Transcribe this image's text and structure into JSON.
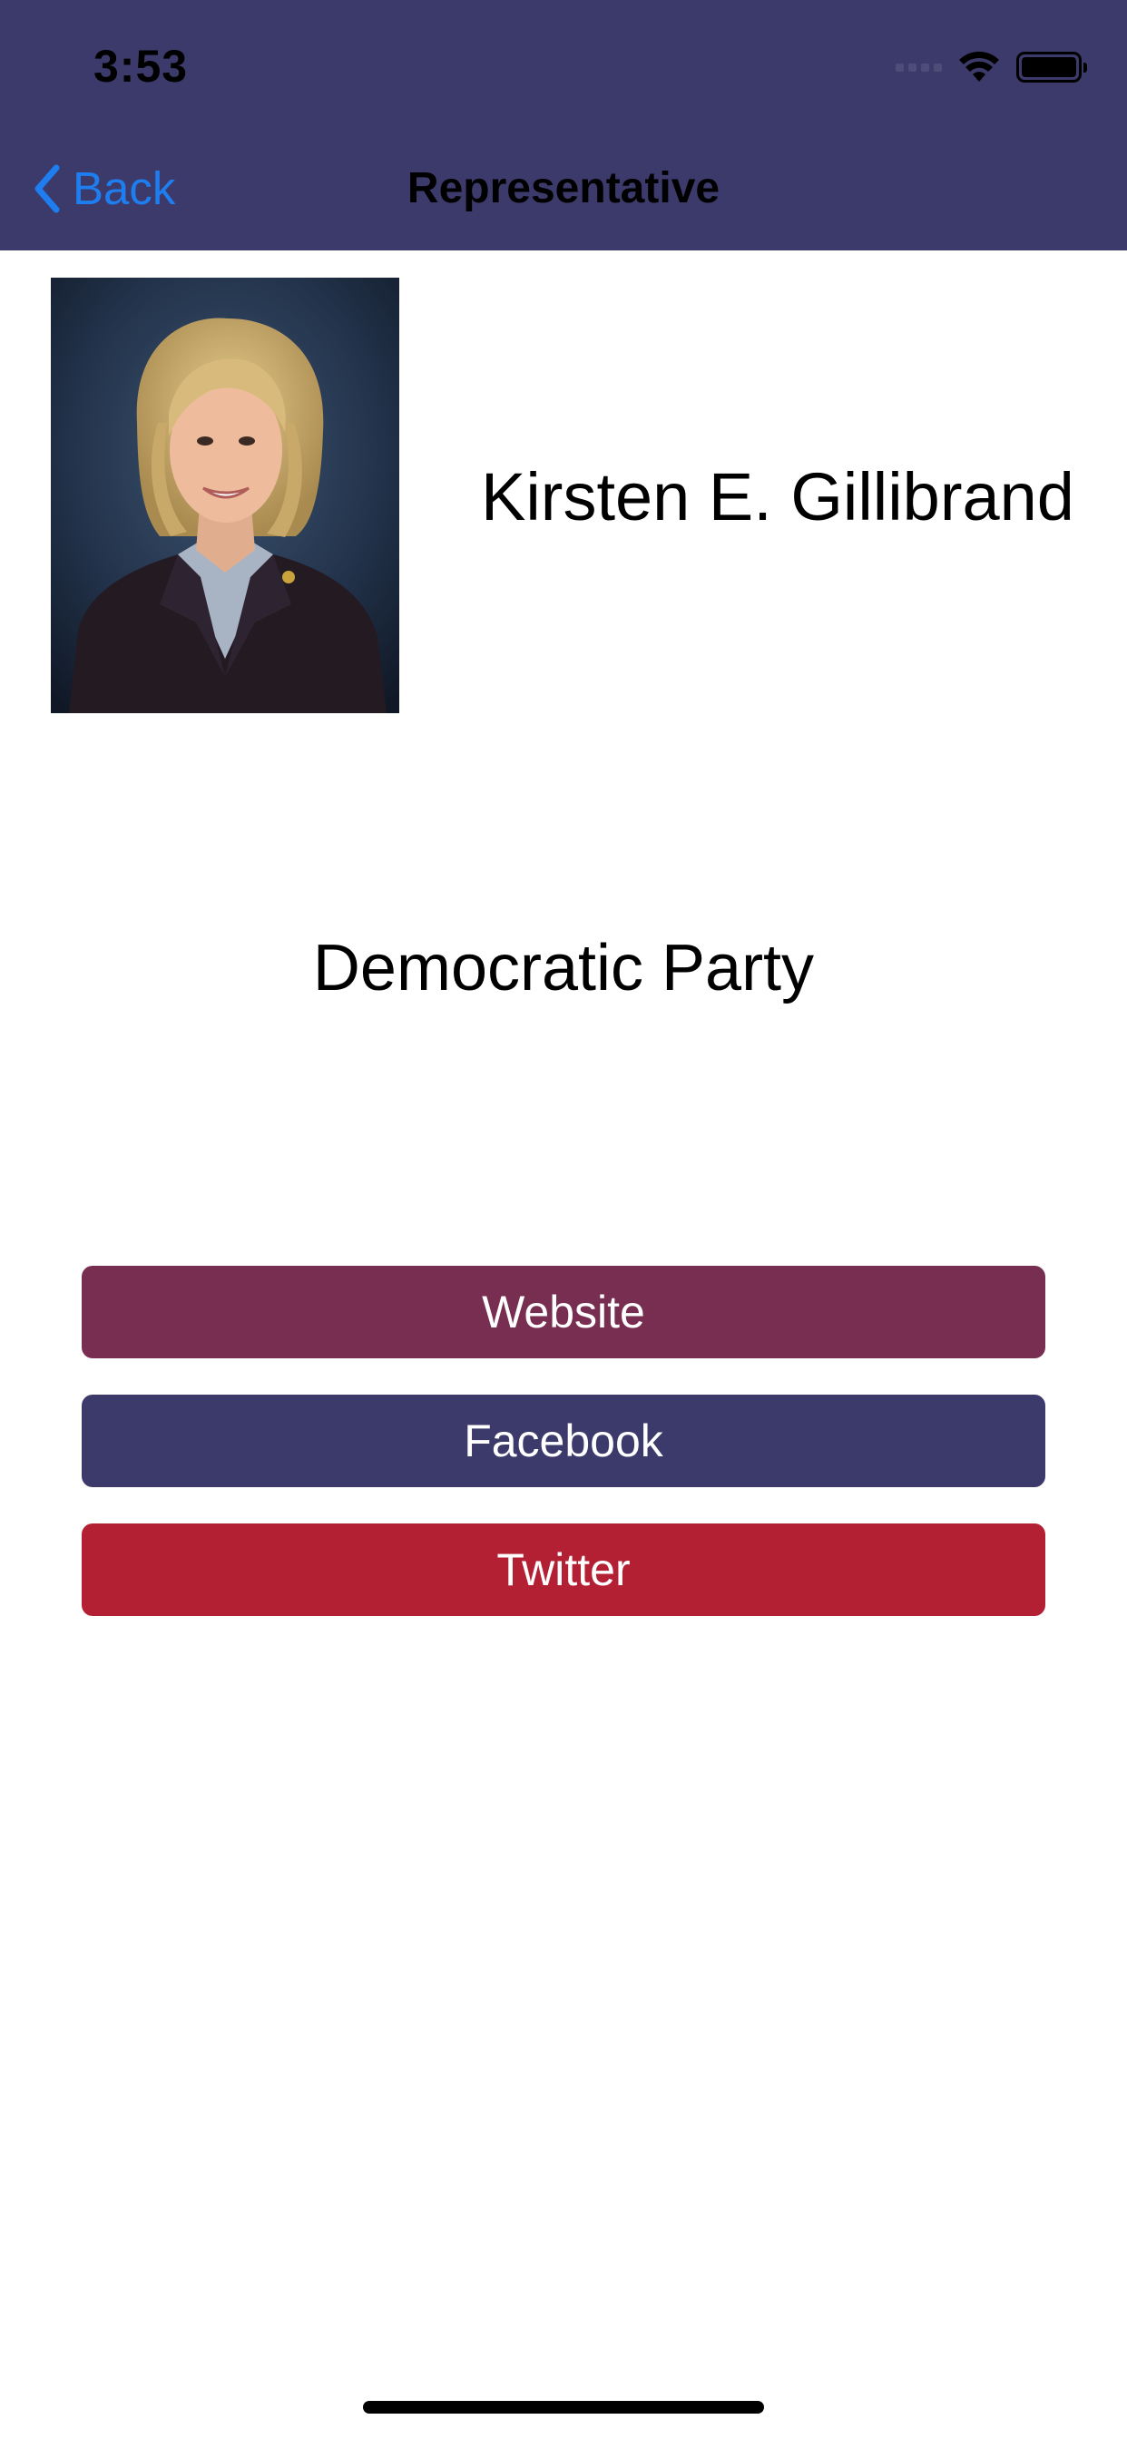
{
  "status_bar": {
    "time": "3:53"
  },
  "nav": {
    "back_label": "Back",
    "title": "Representative",
    "background_color": "#3c3a6b",
    "accent_color": "#1e7ef0"
  },
  "representative": {
    "name": "Kirsten E. Gillibrand",
    "party": "Democratic Party"
  },
  "links": [
    {
      "label": "Website",
      "color": "#772e51"
    },
    {
      "label": "Facebook",
      "color": "#3c3a6b"
    },
    {
      "label": "Twitter",
      "color": "#b32033"
    }
  ]
}
